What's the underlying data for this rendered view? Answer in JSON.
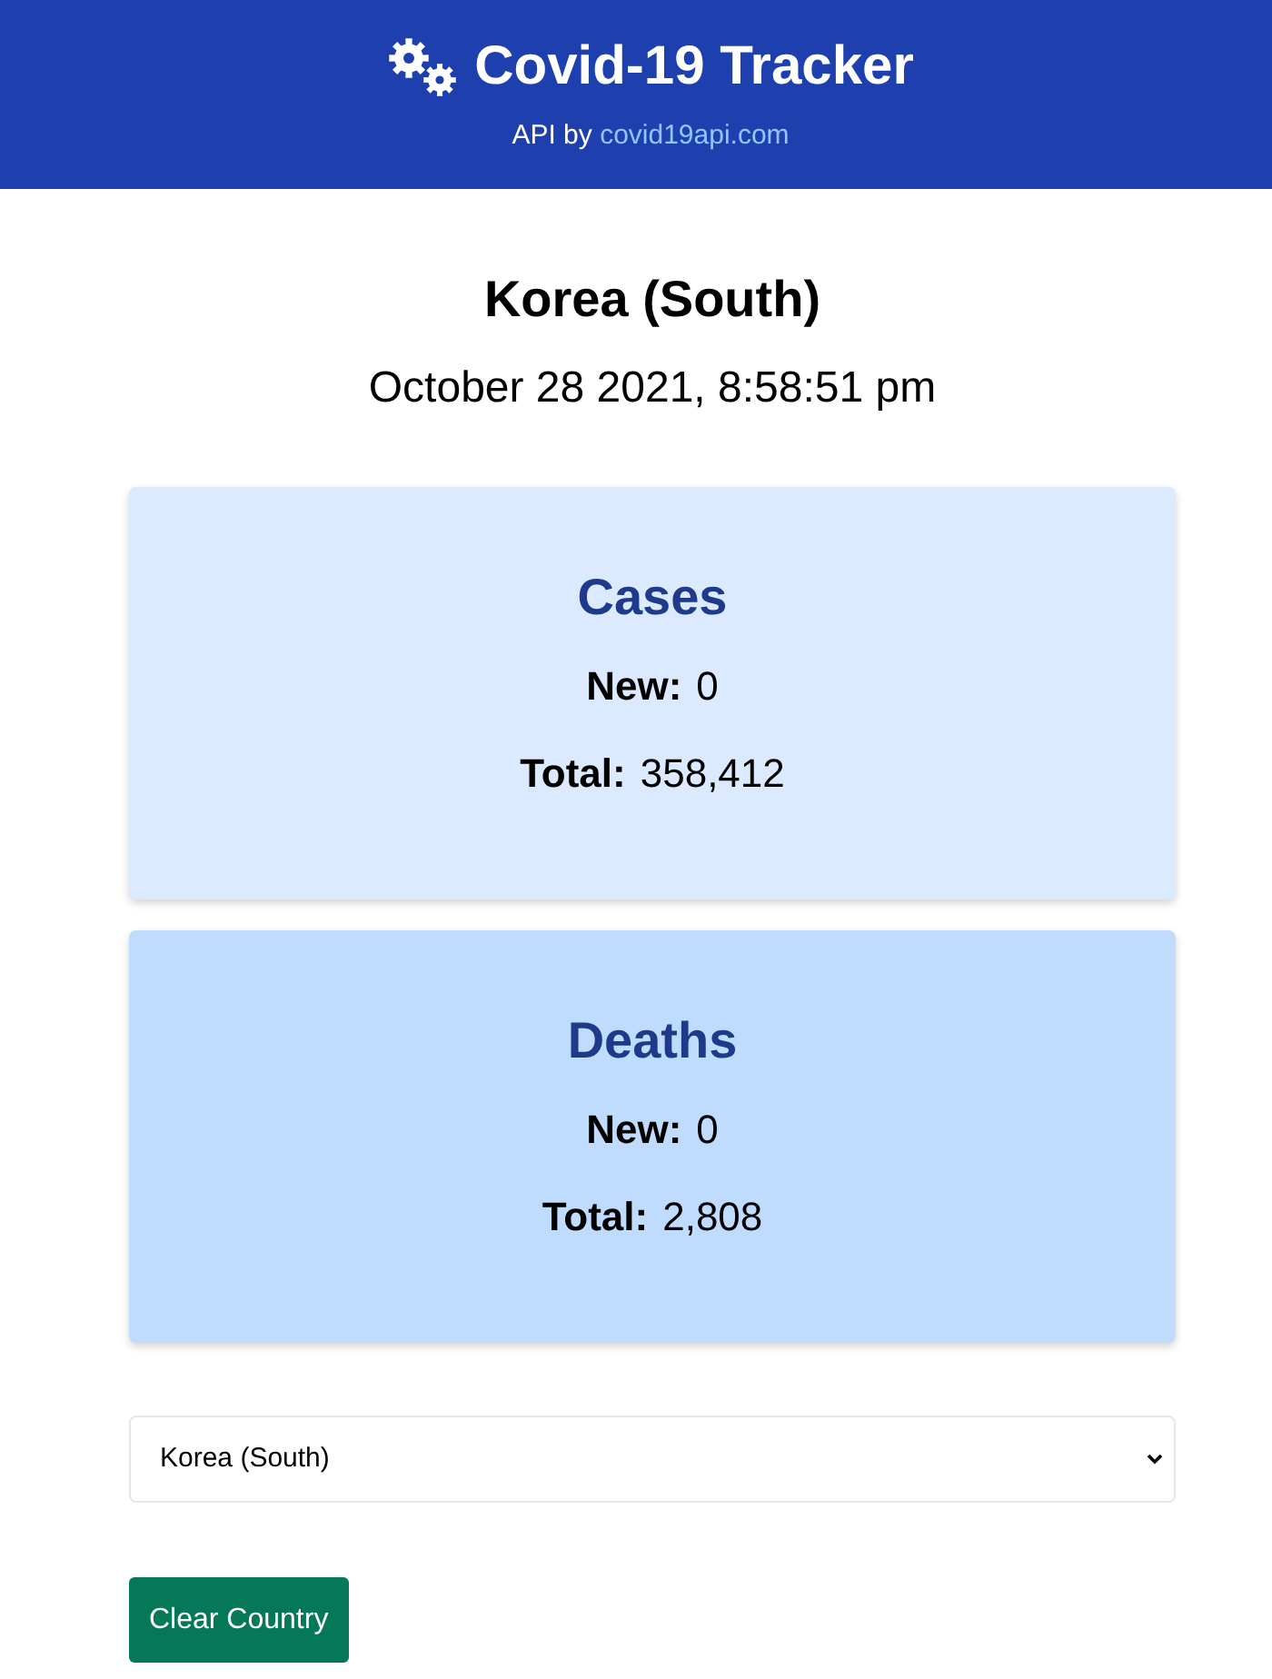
{
  "header": {
    "title": "Covid-19 Tracker",
    "credit": "API by",
    "link": "covid19api.com"
  },
  "country": "Korea (South)",
  "date": "October 28 2021, 8:58:51 pm",
  "cards": [
    {
      "title": "Cases",
      "color": "#dbeafe",
      "stats": [
        {
          "label": "New:",
          "value": "0"
        },
        {
          "label": "Total:",
          "value": "358,412"
        }
      ]
    },
    {
      "title": "Deaths",
      "color": "#bfdbfe",
      "stats": [
        {
          "label": "New:",
          "value": "0"
        },
        {
          "label": "Total:",
          "value": "2,808"
        }
      ]
    }
  ],
  "country_select": {
    "value": "Korea (South)"
  },
  "buttons": [
    "Clear Country"
  ]
}
